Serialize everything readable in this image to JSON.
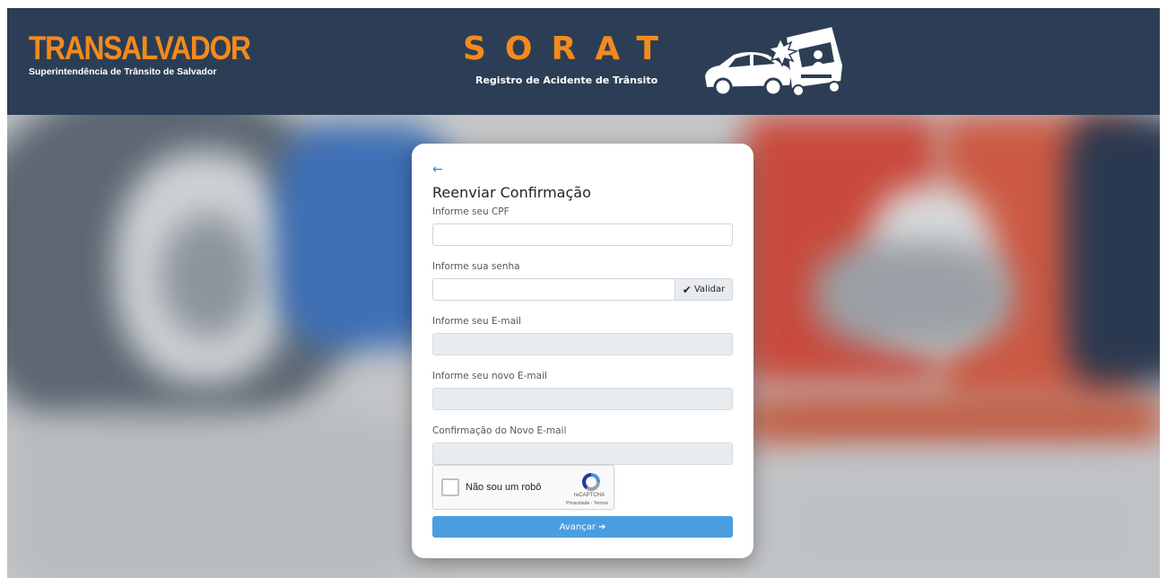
{
  "header": {
    "brand_name": "TRANSALVADOR",
    "brand_subtitle": "Superintendência de Trânsito de Salvador",
    "app_title": "SORAT",
    "app_subtitle": "Registro de Acidente de Trânsito",
    "background_color": "#2c3e55",
    "accent_color": "#f28b1c"
  },
  "form": {
    "back_icon": "arrow-left-icon",
    "back_glyph": "←",
    "title": "Reenviar Confirmação",
    "cpf_label": "Informe seu CPF",
    "cpf_value": "",
    "password_label": "Informe sua senha",
    "password_value": "",
    "validate_icon": "check-icon",
    "validate_glyph": "✔",
    "validate_label": "Validar",
    "email_label": "Informe seu E-mail",
    "email_value": "",
    "new_email_label": "Informe seu novo E-mail",
    "new_email_value": "",
    "confirm_email_label": "Confirmação do Novo E-mail",
    "confirm_email_value": "",
    "submit_label": "Avançar",
    "submit_icon": "arrow-right-icon",
    "submit_glyph": "➔",
    "submit_color": "#4a9ee0"
  },
  "recaptcha": {
    "label": "Não sou um robô",
    "brand": "reCAPTCHA",
    "links": "Privacidade - Termos"
  }
}
